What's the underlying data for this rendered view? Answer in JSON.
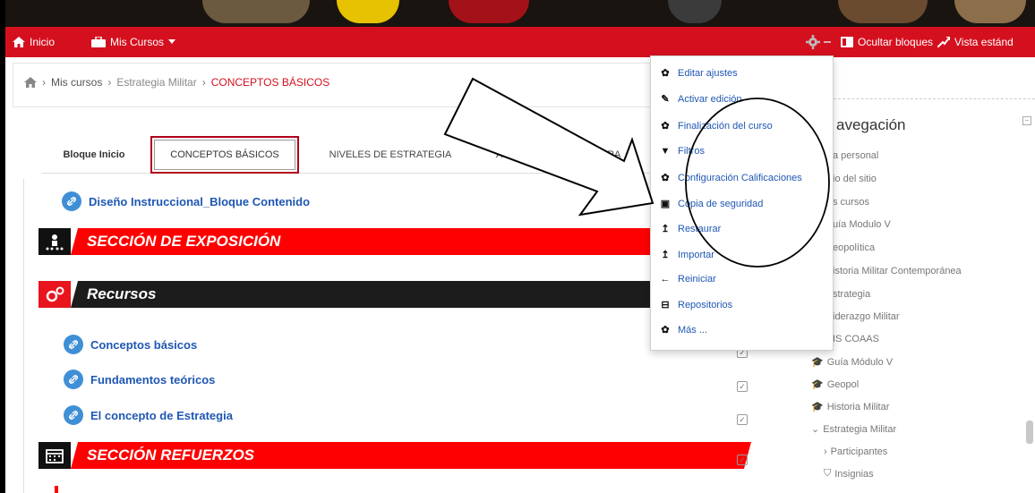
{
  "navbar": {
    "home_label": "Inicio",
    "courses_label": "Mis Cursos",
    "hide_blocks_label": "Ocultar bloques",
    "standard_view_label": "Vista estánd"
  },
  "breadcrumb": {
    "items": [
      "Mis cursos",
      "Estrategia Militar",
      "CONCEPTOS BÁSICOS"
    ]
  },
  "tabs": [
    "Bloque Inicio",
    "CONCEPTOS BÁSICOS",
    "NIVELES DE ESTRATEGIA",
    "ACTVIDAD INTEGRADORA"
  ],
  "content": {
    "top_link": "Diseño Instruccional_Bloque Contenido",
    "section_exposicion": "SECCIÓN DE EXPOSICIÓN",
    "section_recursos": "Recursos",
    "links": [
      "Conceptos básicos",
      "Fundamentos teóricos",
      "El concepto de Estrategia"
    ],
    "section_refuerzos": "SECCIÓN REFUERZOS"
  },
  "navigation": {
    "title": "avegación",
    "items": [
      "a personal",
      "io del sitio",
      "s cursos",
      "uía Modulo V",
      "eopolítica",
      "istoria Militar Contemporánea",
      "strategia",
      "iderazgo Militar",
      "IS COAAS",
      "Guía Módulo V",
      "Geopol",
      "Historia Militar",
      "Estrategia Militar",
      "Participantes",
      "Insignias"
    ]
  },
  "dropdown": {
    "items": [
      {
        "label": "Editar ajustes",
        "icon": "gear-icon"
      },
      {
        "label": "Activar edición",
        "icon": "pencil-icon"
      },
      {
        "label": "Finalización del curso",
        "icon": "gear-icon"
      },
      {
        "label": "Filtros",
        "icon": "filter-icon"
      },
      {
        "label": "Configuración Calificaciones",
        "icon": "gear-icon"
      },
      {
        "label": "Copia de seguridad",
        "icon": "file-icon"
      },
      {
        "label": "Restaurar",
        "icon": "upload-icon"
      },
      {
        "label": "Importar",
        "icon": "upload-icon"
      },
      {
        "label": "Reiniciar",
        "icon": "arrow-left-icon"
      },
      {
        "label": "Repositorios",
        "icon": "drive-icon"
      },
      {
        "label": "Más ...",
        "icon": "gear-icon"
      }
    ]
  },
  "colors": {
    "brand_red": "#d4101f",
    "link_blue": "#1f57b3",
    "section_red": "#ff0000",
    "section_dark": "#1c1c1c"
  }
}
